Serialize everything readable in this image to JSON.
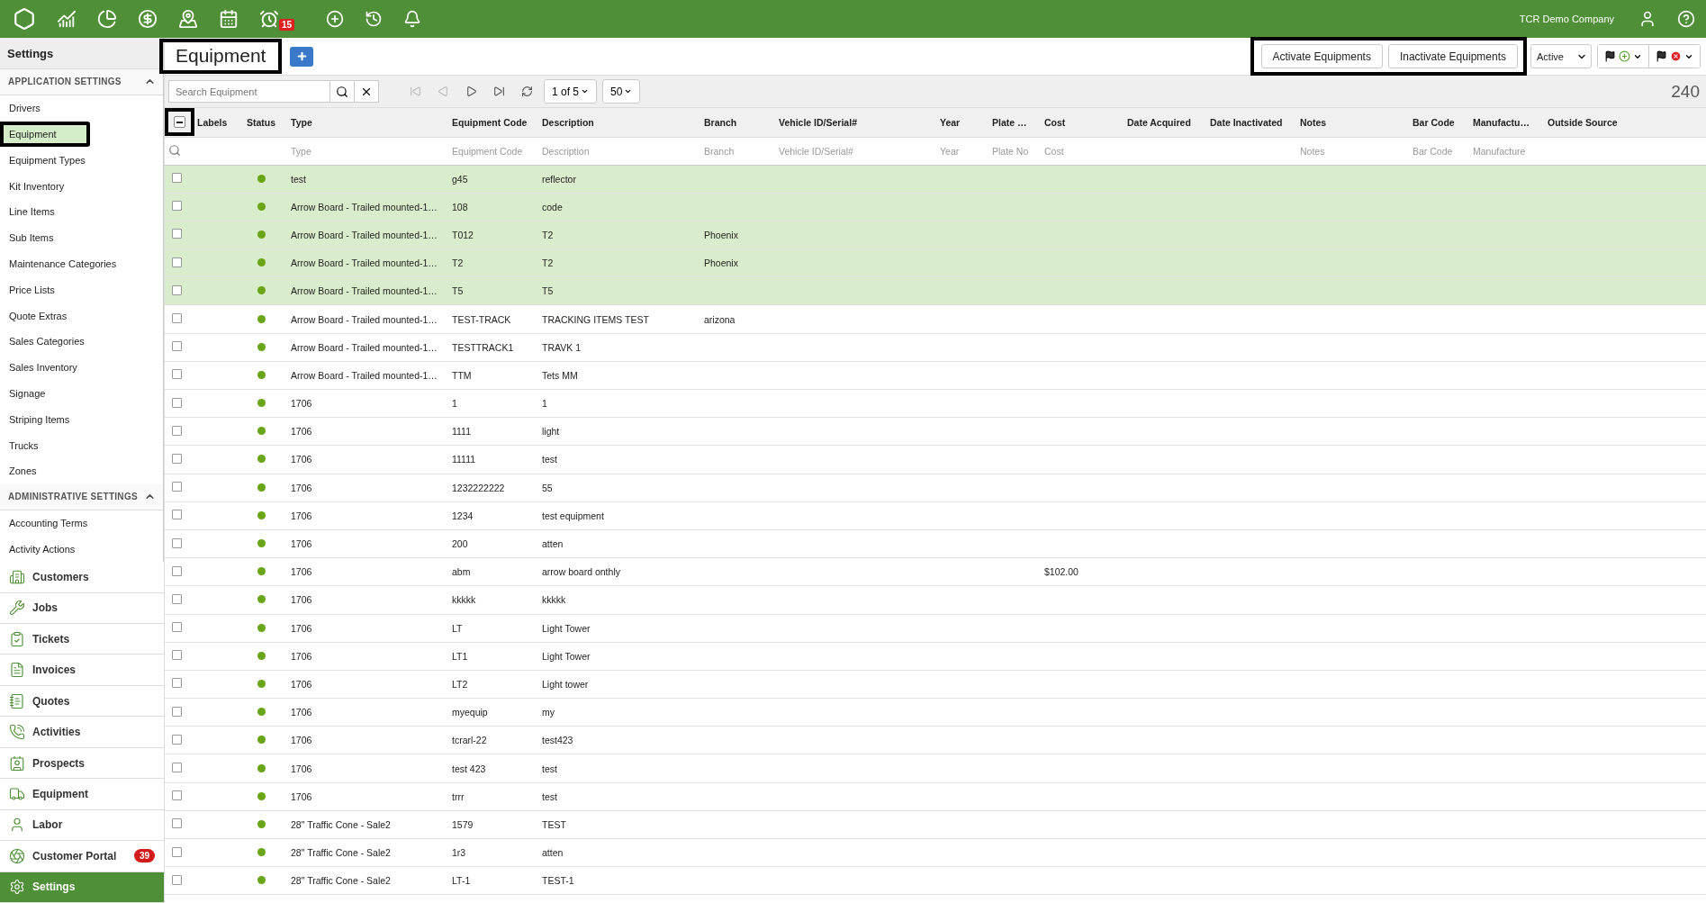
{
  "top_bar": {
    "alarm_badge": "15",
    "company": "TCR Demo Company"
  },
  "sidebar": {
    "title": "Settings",
    "sections": [
      {
        "title": "APPLICATION SETTINGS",
        "expanded": true,
        "items": [
          {
            "label": "Drivers",
            "selected": false,
            "highlighted": false
          },
          {
            "label": "Equipment",
            "selected": true,
            "highlighted": true
          },
          {
            "label": "Equipment Types",
            "selected": false,
            "highlighted": false
          },
          {
            "label": "Kit Inventory",
            "selected": false,
            "highlighted": false
          },
          {
            "label": "Line Items",
            "selected": false,
            "highlighted": false
          },
          {
            "label": "Sub Items",
            "selected": false,
            "highlighted": false
          },
          {
            "label": "Maintenance Categories",
            "selected": false,
            "highlighted": false
          },
          {
            "label": "Price Lists",
            "selected": false,
            "highlighted": false
          },
          {
            "label": "Quote Extras",
            "selected": false,
            "highlighted": false
          },
          {
            "label": "Sales Categories",
            "selected": false,
            "highlighted": false
          },
          {
            "label": "Sales Inventory",
            "selected": false,
            "highlighted": false
          },
          {
            "label": "Signage",
            "selected": false,
            "highlighted": false
          },
          {
            "label": "Striping Items",
            "selected": false,
            "highlighted": false
          },
          {
            "label": "Trucks",
            "selected": false,
            "highlighted": false
          },
          {
            "label": "Zones",
            "selected": false,
            "highlighted": false
          }
        ]
      },
      {
        "title": "ADMINISTRATIVE SETTINGS",
        "expanded": true,
        "items": [
          {
            "label": "Accounting Terms",
            "selected": false,
            "highlighted": false
          },
          {
            "label": "Activity Actions",
            "selected": false,
            "highlighted": false
          }
        ]
      }
    ],
    "modules": [
      {
        "kind": "customers",
        "label": "Customers",
        "selected": false
      },
      {
        "kind": "jobs",
        "label": "Jobs",
        "selected": false
      },
      {
        "kind": "tickets",
        "label": "Tickets",
        "selected": false
      },
      {
        "kind": "invoices",
        "label": "Invoices",
        "selected": false
      },
      {
        "kind": "quotes",
        "label": "Quotes",
        "selected": false
      },
      {
        "kind": "activities",
        "label": "Activities",
        "selected": false
      },
      {
        "kind": "prospects",
        "label": "Prospects",
        "selected": false
      },
      {
        "kind": "equipment",
        "label": "Equipment",
        "selected": false
      },
      {
        "kind": "labor",
        "label": "Labor",
        "selected": false
      },
      {
        "kind": "portal",
        "label": "Customer Portal",
        "selected": false,
        "badge": "39"
      },
      {
        "kind": "settings",
        "label": "Settings",
        "selected": true
      }
    ]
  },
  "header": {
    "title": "Equipment",
    "title_highlighted": true,
    "actions_highlighted": true,
    "actions": [
      "Activate Equipments",
      "Inactivate Equipments"
    ],
    "status_filter": "Active"
  },
  "toolbar": {
    "search_placeholder": "Search Equipment",
    "page": "1 of 5",
    "page_size": "50",
    "total": "240"
  },
  "table": {
    "select_all": {
      "indeterminate": true,
      "highlighted": true
    },
    "columns": [
      {
        "label": "Labels"
      },
      {
        "label": "Status"
      },
      {
        "label": "Type",
        "placeholder": "Type"
      },
      {
        "label": "Equipment Code",
        "placeholder": "Equipment Code"
      },
      {
        "label": "Description",
        "placeholder": "Description"
      },
      {
        "label": "Branch",
        "placeholder": "Branch"
      },
      {
        "label": "Vehicle ID/Serial#",
        "placeholder": "Vehicle ID/Serial#"
      },
      {
        "label": "Year",
        "placeholder": "Year"
      },
      {
        "label": "Plate …",
        "placeholder": "Plate No"
      },
      {
        "label": "Cost",
        "placeholder": "Cost"
      },
      {
        "label": "Date Acquired"
      },
      {
        "label": "Date Inactivated"
      },
      {
        "label": "Notes",
        "placeholder": "Notes"
      },
      {
        "label": "Bar Code",
        "placeholder": "Bar Code"
      },
      {
        "label": "Manufactu…",
        "placeholder": "Manufacture"
      },
      {
        "label": "Outside Source"
      }
    ],
    "rows": [
      {
        "selected": true,
        "active": true,
        "type": "test",
        "code": "g45",
        "description": "reflector"
      },
      {
        "selected": true,
        "active": true,
        "type": "Arrow Board - Trailed mounted-1…",
        "code": "108",
        "description": "code"
      },
      {
        "selected": true,
        "active": true,
        "type": "Arrow Board - Trailed mounted-1…",
        "code": "T012",
        "description": "T2",
        "branch": "Phoenix"
      },
      {
        "selected": true,
        "active": true,
        "type": "Arrow Board - Trailed mounted-1…",
        "code": "T2",
        "description": "T2",
        "branch": "Phoenix"
      },
      {
        "selected": true,
        "active": true,
        "type": "Arrow Board - Trailed mounted-1…",
        "code": "T5",
        "description": "T5"
      },
      {
        "selected": false,
        "active": true,
        "type": "Arrow Board - Trailed mounted-1…",
        "code": "TEST-TRACK",
        "description": "TRACKING ITEMS TEST",
        "branch": "arizona"
      },
      {
        "selected": false,
        "active": true,
        "type": "Arrow Board - Trailed mounted-1…",
        "code": "TESTTRACK1",
        "description": "TRAVK 1"
      },
      {
        "selected": false,
        "active": true,
        "type": "Arrow Board - Trailed mounted-1…",
        "code": "TTM",
        "description": "Tets MM"
      },
      {
        "selected": false,
        "active": true,
        "type": "1706",
        "code": "1",
        "description": "1"
      },
      {
        "selected": false,
        "active": true,
        "type": "1706",
        "code": "1111",
        "description": "light"
      },
      {
        "selected": false,
        "active": true,
        "type": "1706",
        "code": "11111",
        "description": "test"
      },
      {
        "selected": false,
        "active": true,
        "type": "1706",
        "code": "1232222222",
        "description": "55"
      },
      {
        "selected": false,
        "active": true,
        "type": "1706",
        "code": "1234",
        "description": "test equipment"
      },
      {
        "selected": false,
        "active": true,
        "type": "1706",
        "code": "200",
        "description": "atten"
      },
      {
        "selected": false,
        "active": true,
        "type": "1706",
        "code": "abm",
        "description": "arrow board onthly",
        "cost": "$102.00"
      },
      {
        "selected": false,
        "active": true,
        "type": "1706",
        "code": "kkkkk",
        "description": "kkkkk"
      },
      {
        "selected": false,
        "active": true,
        "type": "1706",
        "code": "LT",
        "description": "Light Tower"
      },
      {
        "selected": false,
        "active": true,
        "type": "1706",
        "code": "LT1",
        "description": "Light Tower"
      },
      {
        "selected": false,
        "active": true,
        "type": "1706",
        "code": "LT2",
        "description": "Light tower"
      },
      {
        "selected": false,
        "active": true,
        "type": "1706",
        "code": "myequip",
        "description": "my"
      },
      {
        "selected": false,
        "active": true,
        "type": "1706",
        "code": "tcrarl-22",
        "description": "test423"
      },
      {
        "selected": false,
        "active": true,
        "type": "1706",
        "code": "test 423",
        "description": "test"
      },
      {
        "selected": false,
        "active": true,
        "type": "1706",
        "code": "trrr",
        "description": "test"
      },
      {
        "selected": false,
        "active": true,
        "type": "28\" Traffic Cone - Sale2",
        "code": "1579",
        "description": "TEST"
      },
      {
        "selected": false,
        "active": true,
        "type": "28\" Traffic Cone - Sale2",
        "code": "1r3",
        "description": "atten"
      },
      {
        "selected": false,
        "active": true,
        "type": "28\" Traffic Cone - Sale2",
        "code": "LT-1",
        "description": "TEST-1"
      }
    ]
  }
}
